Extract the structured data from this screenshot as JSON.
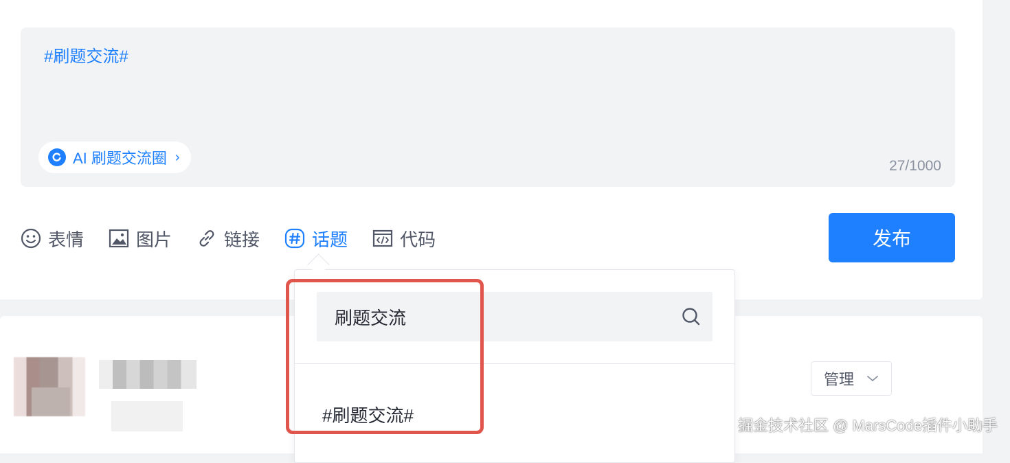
{
  "editor": {
    "content": "#刷题交流#",
    "circle_tag": "AI 刷题交流圈",
    "char_count": "27/1000"
  },
  "toolbar": {
    "emoji_label": "表情",
    "image_label": "图片",
    "link_label": "链接",
    "topic_label": "话题",
    "code_label": "代码",
    "publish_label": "发布",
    "active_tool": "topic"
  },
  "topic_popover": {
    "search_value": "刷题交流",
    "result_item": "#刷题交流#"
  },
  "post": {
    "manage_label": "管理"
  },
  "watermark": "掘金技术社区 @ MarsCode插件小助手",
  "colors": {
    "accent": "#1e80ff",
    "highlight_border": "#e0564c",
    "editor_bg": "#f2f3f5"
  }
}
